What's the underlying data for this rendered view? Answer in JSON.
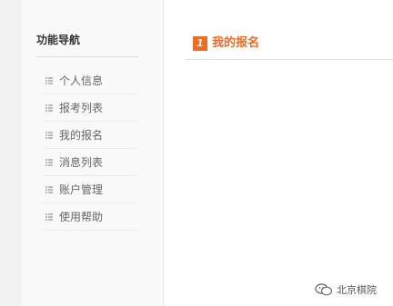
{
  "sidebar": {
    "title": "功能导航",
    "items": [
      {
        "label": "个人信息",
        "icon": "list-icon"
      },
      {
        "label": "报考列表",
        "icon": "list-icon"
      },
      {
        "label": "我的报名",
        "icon": "list-icon"
      },
      {
        "label": "消息列表",
        "icon": "list-icon"
      },
      {
        "label": "账户管理",
        "icon": "list-icon"
      },
      {
        "label": "使用帮助",
        "icon": "list-icon"
      }
    ]
  },
  "main": {
    "section_number": "1",
    "section_title": "我的报名"
  },
  "watermark": {
    "text": "北京棋院",
    "icon": "wechat-icon"
  },
  "colors": {
    "accent": "#f26b21",
    "sidebar_bg": "#f9f9f9",
    "page_bg": "#f2f2f2"
  }
}
